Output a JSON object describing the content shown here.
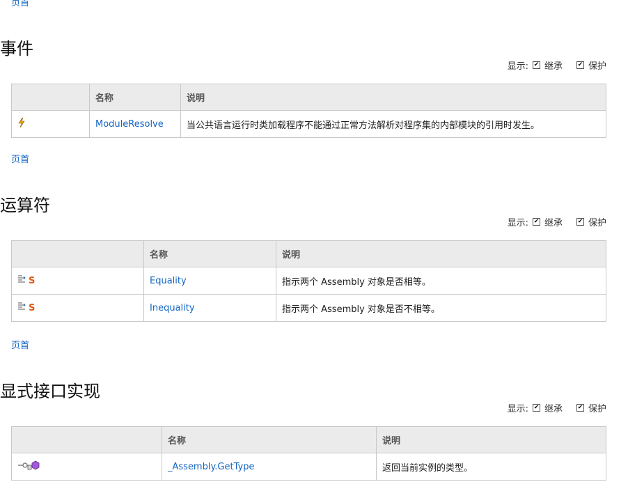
{
  "back_to_top": "页首",
  "filters": {
    "show": "显示:",
    "inherited": "继承",
    "protected": "保护"
  },
  "sections": [
    {
      "title": "事件",
      "headers": [
        "",
        "名称",
        "说明"
      ],
      "rows": [
        {
          "icon": "event-icon",
          "name": "ModuleResolve",
          "desc": "当公共语言运行时类加载程序不能通过正常方法解析对程序集的内部模块的引用时发生。"
        }
      ]
    },
    {
      "title": "运算符",
      "headers": [
        "",
        "名称",
        "说明"
      ],
      "rows": [
        {
          "icon": "static-operator-icon",
          "name": "Equality",
          "desc": "指示两个 Assembly 对象是否相等。"
        },
        {
          "icon": "static-operator-icon",
          "name": "Inequality",
          "desc": "指示两个 Assembly 对象是否不相等。"
        }
      ]
    },
    {
      "title": "显式接口实现",
      "headers": [
        "",
        "名称",
        "说明"
      ],
      "rows": [
        {
          "icon": "explicit-interface-method-icon",
          "name": "_Assembly.GetType",
          "desc": "返回当前实例的类型。"
        }
      ]
    }
  ]
}
